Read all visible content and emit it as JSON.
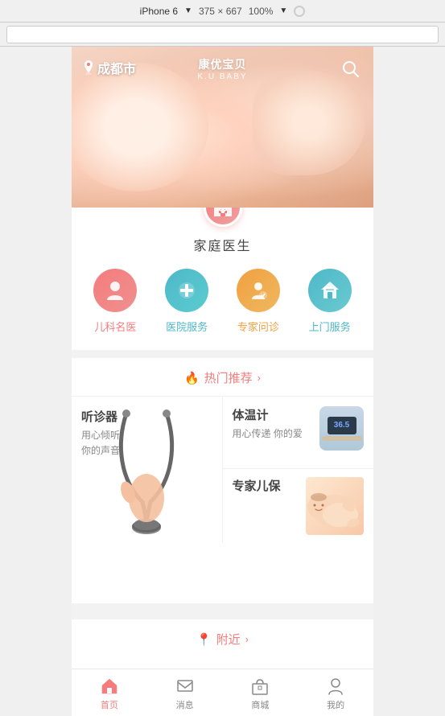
{
  "topbar": {
    "device": "iPhone 6",
    "arrow": "▼",
    "width": "375",
    "x": "×",
    "height": "667",
    "zoom": "100%",
    "zoom_arrow": "▼"
  },
  "hero": {
    "location": "成都市",
    "logo_main": "康优宝贝",
    "logo_sub": "K.U BABY"
  },
  "medical": {
    "title": "家庭医生",
    "icons": [
      {
        "id": "pediatrician",
        "label": "儿科名医",
        "color_class": "icon-pink",
        "label_class": "label-pink"
      },
      {
        "id": "hospital",
        "label": "医院服务",
        "color_class": "icon-blue",
        "label_class": "label-blue"
      },
      {
        "id": "expert",
        "label": "专家问诊",
        "color_class": "icon-orange",
        "label_class": "label-orange"
      },
      {
        "id": "home",
        "label": "上门服务",
        "color_class": "icon-teal",
        "label_class": "label-teal"
      }
    ]
  },
  "recommend": {
    "header": "热门推荐",
    "items": [
      {
        "id": "stethoscope",
        "title": "听诊器",
        "desc": "用心倾听\n你的声音"
      },
      {
        "id": "thermometer",
        "title": "体温计",
        "desc": "用心传递\n你的爱"
      },
      {
        "id": "expert-child",
        "title": "专家儿保",
        "desc": ""
      }
    ]
  },
  "nearby": {
    "header": "附近"
  },
  "nav": {
    "items": [
      {
        "id": "home",
        "label": "首页",
        "active": true
      },
      {
        "id": "message",
        "label": "消息",
        "active": false
      },
      {
        "id": "shop",
        "label": "商城",
        "active": false
      },
      {
        "id": "profile",
        "label": "我的",
        "active": false
      }
    ]
  }
}
